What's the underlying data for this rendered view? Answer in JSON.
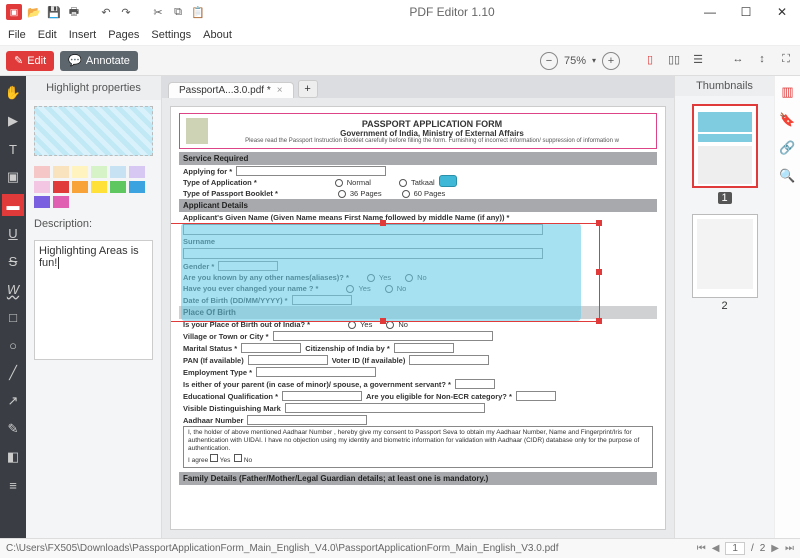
{
  "app": {
    "title": "PDF Editor 1.10"
  },
  "menubar": {
    "file": "File",
    "edit": "Edit",
    "insert": "Insert",
    "pages": "Pages",
    "settings": "Settings",
    "about": "About"
  },
  "toolbar": {
    "edit": "Edit",
    "annotate": "Annotate",
    "zoom": "75%"
  },
  "tabs": {
    "doc": "PassportA...3.0.pdf *"
  },
  "props": {
    "title": "Highlight properties",
    "desc_label": "Description:",
    "desc_value": "Highlighting Areas is fun!",
    "swatches": [
      "#f6c7c7",
      "#f9e3bf",
      "#fff3bf",
      "#d6f3c7",
      "#c7e3f3",
      "#d7c7f3",
      "#f3c7e3",
      "#e03a3a",
      "#f7a33a",
      "#ffe13a",
      "#5fc75f",
      "#3aa3e0",
      "#7a5fe0",
      "#e05fb2"
    ]
  },
  "thumbs": {
    "title": "Thumbnails",
    "p1": "1",
    "p2": "2"
  },
  "status": {
    "path": "C:\\Users\\FX505\\Downloads\\PassportApplicationForm_Main_English_V4.0\\PassportApplicationForm_Main_English_V3.0.pdf",
    "page_current": "1",
    "page_sep": "/",
    "page_total": "2"
  },
  "form": {
    "title1": "PASSPORT APPLICATION FORM",
    "title2": "Government of India, Ministry of External Affairs",
    "title3": "Please read the Passport Instruction Booklet carefully before filling the form. Furnishing of incorrect information/ suppression of information w",
    "sec_service": "Service Required",
    "applying_for": "Applying for *",
    "type_app": "Type of Application *",
    "normal": "Normal",
    "tatkaal": "Tatkaal",
    "type_booklet": "Type of Passport Booklet *",
    "p36": "36 Pages",
    "p60": "60 Pages",
    "sec_applicant": "Applicant Details",
    "given_name": "Applicant's Given Name (Given Name means First Name followed by middle Name (if any)) *",
    "surname": "Surname",
    "gender": "Gender *",
    "aliases": "Are you known by any other names(aliases)? *",
    "name_changed": "Have you ever changed your name ? *",
    "yes": "Yes",
    "no": "No",
    "dob": "Date of Birth (DD/MM/YYYY) *",
    "sec_pob": "Place Of Birth",
    "pob_out": "Is your Place of Birth out of India? *",
    "village": "Village or Town or City *",
    "marital": "Marital Status *",
    "citizenship": "Citizenship of India by *",
    "pan": "PAN (If available)",
    "voter": "Voter ID (If available)",
    "emp_type": "Employment Type *",
    "parent_gov": "Is either of your parent (in case of minor)/ spouse, a government servant? *",
    "edu": "Educational Qualification *",
    "non_ecr": "Are you eligible for Non-ECR category? *",
    "dist_mark": "Visible Distinguishing Mark",
    "aadhaar": "Aadhaar Number",
    "aadhaar_consent": "I, the holder of above mentioned Aadhaar Number , hereby give my consent to Passport Seva to obtain my Aadhaar Number, Name and Fingerprint/Iris for authentication with UIDAI. I have no objection using my identity and biometric information for validation with Aadhaar (CIDR) database only for the purpose of authentication.",
    "agree": "I agree",
    "sec_family": "Family Details (Father/Mother/Legal Guardian details; at least one is mandatory.)"
  }
}
